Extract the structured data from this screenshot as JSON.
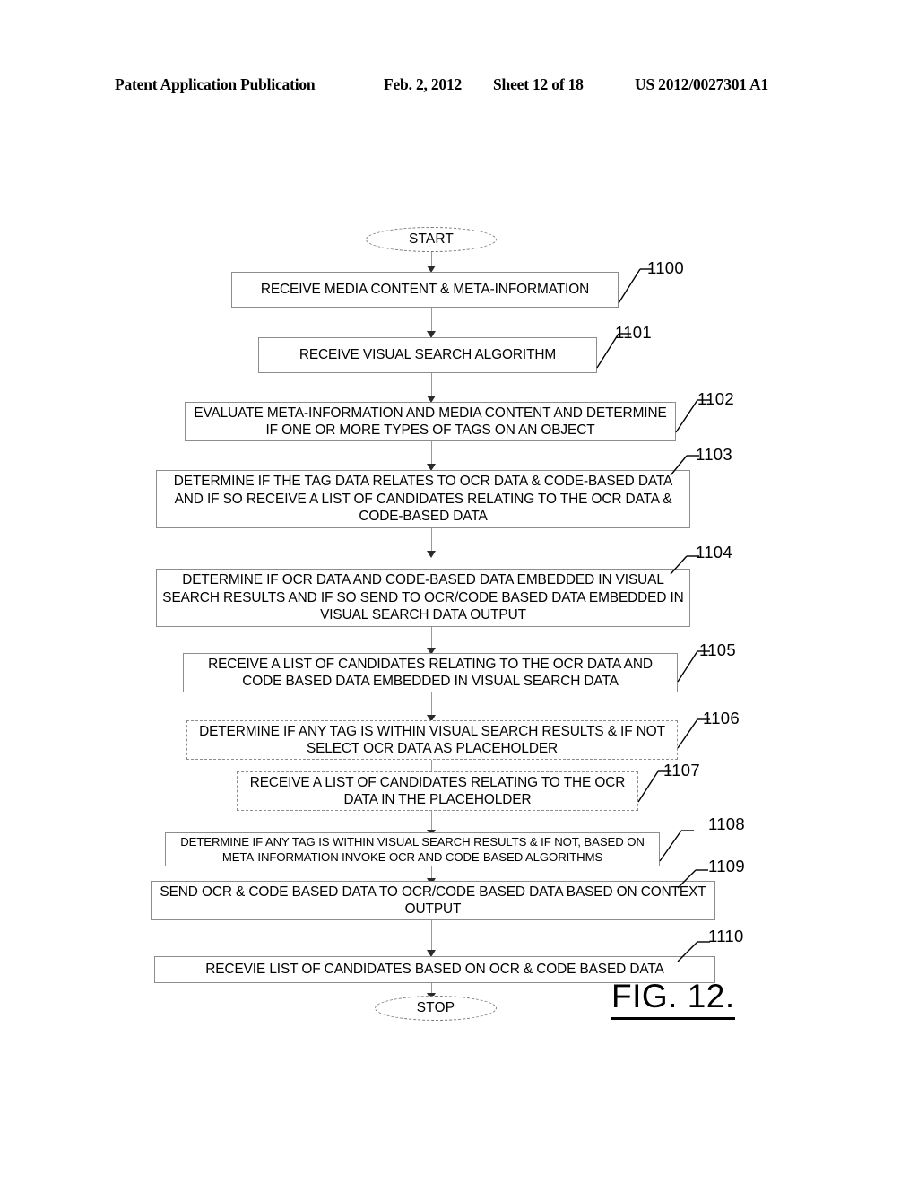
{
  "header": {
    "publication": "Patent Application Publication",
    "date": "Feb. 2, 2012",
    "sheet": "Sheet 12 of 18",
    "number": "US 2012/0027301 A1"
  },
  "figure": {
    "caption": "FIG. 12."
  },
  "flowchart": {
    "start_label": "START",
    "stop_label": "STOP",
    "steps": [
      {
        "ref": "1100",
        "text": "RECEIVE MEDIA CONTENT & META-INFORMATION",
        "border": "solid"
      },
      {
        "ref": "1101",
        "text": "RECEIVE VISUAL SEARCH ALGORITHM",
        "border": "solid"
      },
      {
        "ref": "1102",
        "text": "EVALUATE META-INFORMATION AND MEDIA CONTENT AND DETERMINE IF ONE OR MORE TYPES OF TAGS ON AN OBJECT",
        "border": "solid"
      },
      {
        "ref": "1103",
        "text": "DETERMINE IF THE TAG DATA RELATES TO OCR DATA & CODE-BASED DATA AND IF SO RECEIVE A LIST OF CANDIDATES RELATING TO THE OCR DATA & CODE-BASED DATA",
        "border": "solid"
      },
      {
        "ref": "1104",
        "text": "DETERMINE IF OCR DATA AND CODE-BASED DATA EMBEDDED IN VISUAL SEARCH RESULTS AND IF SO SEND TO OCR/CODE BASED DATA EMBEDDED IN VISUAL SEARCH DATA OUTPUT",
        "border": "solid"
      },
      {
        "ref": "1105",
        "text": "RECEIVE A LIST OF CANDIDATES RELATING TO THE OCR DATA AND CODE BASED DATA EMBEDDED IN VISUAL SEARCH DATA",
        "border": "solid"
      },
      {
        "ref": "1106",
        "text": "DETERMINE IF ANY TAG IS WITHIN VISUAL SEARCH RESULTS & IF NOT SELECT OCR DATA AS PLACEHOLDER",
        "border": "dashed"
      },
      {
        "ref": "1107",
        "text": "RECEIVE A LIST OF CANDIDATES RELATING TO THE OCR DATA IN THE PLACEHOLDER",
        "border": "dashed"
      },
      {
        "ref": "1108",
        "text": "DETERMINE IF ANY TAG IS WITHIN VISUAL SEARCH RESULTS & IF NOT, BASED ON META-INFORMATION INVOKE OCR AND CODE-BASED ALGORITHMS",
        "border": "solid"
      },
      {
        "ref": "1109",
        "text": "SEND OCR & CODE BASED DATA TO OCR/CODE BASED DATA BASED ON CONTEXT OUTPUT",
        "border": "solid"
      },
      {
        "ref": "1110",
        "text": "RECEVIE LIST OF CANDIDATES BASED ON OCR & CODE BASED DATA",
        "border": "solid"
      }
    ]
  }
}
